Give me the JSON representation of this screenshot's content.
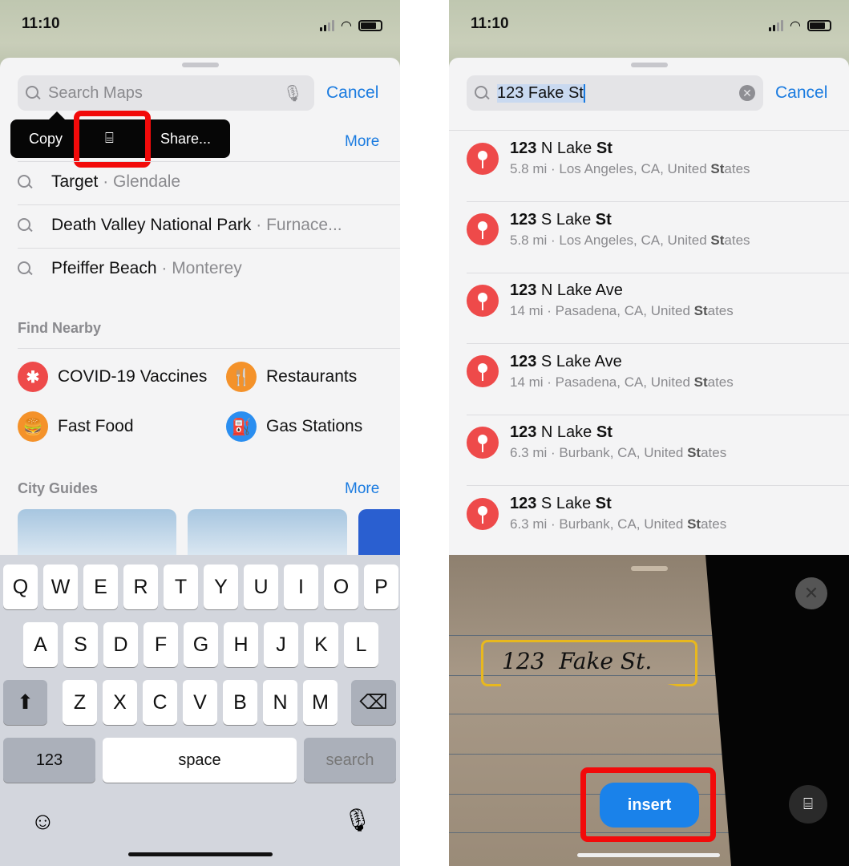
{
  "status": {
    "time": "11:10"
  },
  "left": {
    "search": {
      "placeholder": "Search Maps",
      "cancel": "Cancel"
    },
    "menu": {
      "copy": "Copy",
      "share": "Share..."
    },
    "recents_more": "More",
    "recents": [
      {
        "name": "Target",
        "sub": " · Glendale"
      },
      {
        "name": "Death Valley National Park",
        "sub": " · Furnace..."
      },
      {
        "name": "Pfeiffer Beach",
        "sub": " · Monterey"
      }
    ],
    "find_nearby": "Find Nearby",
    "nearby": [
      {
        "label": "COVID-19 Vaccines",
        "icon": "asterisk-icon",
        "glyph": "✱",
        "color": "#ee4a4a"
      },
      {
        "label": "Restaurants",
        "icon": "fork-knife-icon",
        "glyph": "🍴",
        "color": "#f4922a"
      },
      {
        "label": "Fast Food",
        "icon": "burger-icon",
        "glyph": "🍔",
        "color": "#f4922a"
      },
      {
        "label": "Gas Stations",
        "icon": "fuel-pump-icon",
        "glyph": "⛽",
        "color": "#2a8ef0"
      }
    ],
    "city_guides": "City Guides",
    "city_more": "More",
    "keyboard": {
      "row1": [
        "Q",
        "W",
        "E",
        "R",
        "T",
        "Y",
        "U",
        "I",
        "O",
        "P"
      ],
      "row2": [
        "A",
        "S",
        "D",
        "F",
        "G",
        "H",
        "J",
        "K",
        "L"
      ],
      "row3": [
        "Z",
        "X",
        "C",
        "V",
        "B",
        "N",
        "M"
      ],
      "numbers": "123",
      "space": "space",
      "search": "search"
    }
  },
  "right": {
    "search": {
      "value": "123 Fake St",
      "cancel": "Cancel"
    },
    "results": [
      {
        "num": "123",
        "mid": " N Lake ",
        "st": "St",
        "dist": "5.8 mi · Los Angeles, CA, United ",
        "stb": "St",
        "end": "ates"
      },
      {
        "num": "123",
        "mid": " S Lake ",
        "st": "St",
        "dist": "5.8 mi · Los Angeles, CA, United ",
        "stb": "St",
        "end": "ates"
      },
      {
        "num": "123",
        "mid": " N Lake Ave",
        "st": "",
        "dist": "14 mi · Pasadena, CA, United ",
        "stb": "St",
        "end": "ates"
      },
      {
        "num": "123",
        "mid": " S Lake Ave",
        "st": "",
        "dist": "14 mi · Pasadena, CA, United ",
        "stb": "St",
        "end": "ates"
      },
      {
        "num": "123",
        "mid": " N Lake ",
        "st": "St",
        "dist": "6.3 mi · Burbank, CA, United ",
        "stb": "St",
        "end": "ates"
      },
      {
        "num": "123",
        "mid": " S Lake ",
        "st": "St",
        "dist": "6.3 mi · Burbank, CA, United ",
        "stb": "St",
        "end": "ates"
      }
    ],
    "handwriting": "123  Fake St.",
    "insert": "insert"
  },
  "colors": {
    "accent": "#1a7be0",
    "highlight": "#f20a0a",
    "insert": "#1a82ea",
    "pin": "#ee4a4a"
  }
}
